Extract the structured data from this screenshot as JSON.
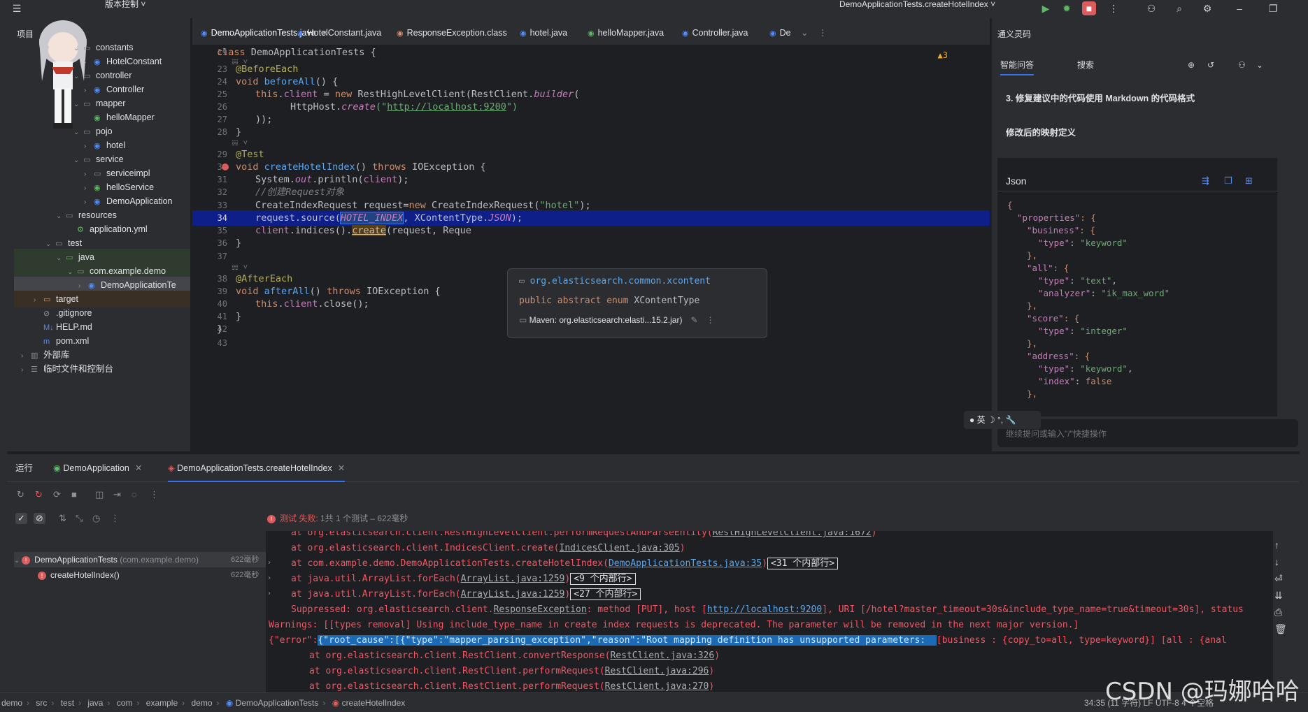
{
  "titlebar": {
    "vcs": "版本控制 ˅",
    "run_config": "DemoApplicationTests.createHotelIndex ˅"
  },
  "project": {
    "title": "项目",
    "items": [
      {
        "label": "constants",
        "type": "folder"
      },
      {
        "label": "HotelConstant",
        "type": "class"
      },
      {
        "label": "controller",
        "type": "folder"
      },
      {
        "label": "Controller",
        "type": "class"
      },
      {
        "label": "mapper",
        "type": "folder"
      },
      {
        "label": "helloMapper",
        "type": "interface"
      },
      {
        "label": "pojo",
        "type": "folder"
      },
      {
        "label": "hotel",
        "type": "class"
      },
      {
        "label": "service",
        "type": "folder"
      },
      {
        "label": "serviceimpl",
        "type": "folder"
      },
      {
        "label": "helloService",
        "type": "interface"
      },
      {
        "label": "DemoApplication",
        "type": "class"
      },
      {
        "label": "resources",
        "type": "folder"
      },
      {
        "label": "application.yml",
        "type": "file"
      },
      {
        "label": "test",
        "type": "folder"
      },
      {
        "label": "java",
        "type": "folder"
      },
      {
        "label": "com.example.demo",
        "type": "folder"
      },
      {
        "label": "DemoApplicationTe",
        "type": "class"
      },
      {
        "label": "target",
        "type": "folder"
      },
      {
        "label": ".gitignore",
        "type": "file"
      },
      {
        "label": "HELP.md",
        "type": "file"
      },
      {
        "label": "pom.xml",
        "type": "file"
      },
      {
        "label": "外部库",
        "type": "folder"
      },
      {
        "label": "临时文件和控制台",
        "type": "folder"
      }
    ]
  },
  "tabs": [
    {
      "label": "DemoApplicationTests.java",
      "active": true
    },
    {
      "label": "HotelConstant.java"
    },
    {
      "label": "ResponseException.class"
    },
    {
      "label": "hotel.java"
    },
    {
      "label": "helloMapper.java"
    },
    {
      "label": "Controller.java"
    },
    {
      "label": "De"
    }
  ],
  "editor": {
    "warnings": "▲3",
    "lines": {
      "l19": "19",
      "l23": "23",
      "l24": "24",
      "l25": "25",
      "l26": "26",
      "l27": "27",
      "l28": "28",
      "l29": "29",
      "l30": "30",
      "l31": "31",
      "l32": "32",
      "l33": "33",
      "l34": "34",
      "l35": "35",
      "l36": "36",
      "l37": "37",
      "l38": "38",
      "l39": "39",
      "l40": "40",
      "l41": "41",
      "l42": "42",
      "l43": "43"
    },
    "code": {
      "c19a": "class ",
      "c19b": "DemoApplicationTests {",
      "c23": "@BeforeEach",
      "c24a": "void ",
      "c24b": "beforeAll",
      "c24c": "() {",
      "c25a": "this",
      "c25b": ".",
      "c25c": "client",
      "c25d": " = ",
      "c25e": "new ",
      "c25f": "RestHighLevelClient(RestClient.",
      "c25g": "builder",
      "c25h": "(",
      "c26a": "HttpHost.",
      "c26b": "create",
      "c26c": "(\"",
      "c26d": "http://localhost:9200",
      "c26e": "\")",
      "c27": "));",
      "c28": "}",
      "c29": "@Test",
      "c30a": "void ",
      "c30b": "createHotelIndex",
      "c30c": "() ",
      "c30d": "throws ",
      "c30e": "IOException {",
      "c31a": "System.",
      "c31b": "out",
      "c31c": ".println(",
      "c31d": "client",
      "c31e": ");",
      "c32": "//创建Request对象",
      "c33a": "CreateIndexRequest request=",
      "c33b": "new ",
      "c33c": "CreateIndexRequest(",
      "c33d": "\"hotel\"",
      "c33e": ");",
      "c34a": "request.source(",
      "c34b": "HOTEL_INDEX",
      "c34c": ", XContentType.",
      "c34d": "JSON",
      "c34e": ");",
      "c35a": "client",
      "c35b": ".indices().",
      "c35c": "create",
      "c35d": "(request, Reque",
      "c36": "}",
      "c38": "@AfterEach",
      "c39a": "void ",
      "c39b": "afterAll",
      "c39c": "() ",
      "c39d": "throws ",
      "c39e": "IOException {",
      "c40a": "this",
      "c40b": ".",
      "c40c": "client",
      "c40d": ".close();",
      "c41": "}",
      "c42": "}"
    },
    "inlay": "𝍕 ˅",
    "popup": {
      "package": "org.elasticsearch.common.xcontent",
      "sig_a": "public abstract enum ",
      "sig_b": "XContentType",
      "maven": "Maven: org.elasticsearch:elasti...15.2.jar)"
    }
  },
  "ai": {
    "title": "通义灵码",
    "tab_chat": "智能问答",
    "tab_search": "搜索",
    "msg1": "3. 修复建议中的代码使用 Markdown 的代码格式",
    "msg2": "修改后的映射定义",
    "json_label": "Json",
    "json_lines": {
      "j1": "{",
      "j2k": "\"properties\"",
      "j2r": ": {",
      "j3k": "\"business\"",
      "j3r": ": {",
      "j4k": "\"type\"",
      "j4v": "\"keyword\"",
      "j5": "},",
      "j6k": "\"all\"",
      "j6r": ": {",
      "j7k": "\"type\"",
      "j7v": "\"text\"",
      "j8k": "\"analyzer\"",
      "j8v": "\"ik_max_word\"",
      "j9": "},",
      "j10k": "\"score\"",
      "j10r": ": {",
      "j11k": "\"type\"",
      "j11v": "\"integer\"",
      "j12": "},",
      "j13k": "\"address\"",
      "j13r": ": {",
      "j14k": "\"type\"",
      "j14v": "\"keyword\"",
      "j15k": "\"index\"",
      "j15v": "false",
      "j16": "},"
    },
    "input_placeholder": "继续提问或输入\"/\"快捷操作",
    "ime": "● 英 ☽ °, 🔧"
  },
  "run": {
    "label": "运行",
    "tab1": "DemoApplication",
    "tab2": "DemoApplicationTests.createHotelIndex",
    "status_a": "测试 失败:",
    "status_b": " 1共 1 个测试 – 622毫秒",
    "tree": {
      "root": "DemoApplicationTests",
      "root_pkg": " (com.example.demo)",
      "root_time": "622毫秒",
      "child": "createHotelIndex()",
      "child_time": "622毫秒"
    },
    "console": {
      "l1a": "at org.elasticsearch.client.RestHighLevelClient.performRequestAndParseEntity(",
      "l1b": "RestHighLevelClient.java:1672",
      "l1c": ")",
      "l2a": "at org.elasticsearch.client.IndicesClient.create(",
      "l2b": "IndicesClient.java:305",
      "l2c": ")",
      "l3a": "at com.example.demo.DemoApplicationTests.createHotelIndex(",
      "l3b": "DemoApplicationTests.java:35",
      "l3c": ")",
      "l3d": "<31 个内部行>",
      "l4a": "at java.util.ArrayList.forEach(",
      "l4b": "ArrayList.java:1259",
      "l4c": ")",
      "l4d": "<9 个内部行>",
      "l5a": "at java.util.ArrayList.forEach(",
      "l5b": "ArrayList.java:1259",
      "l5c": ")",
      "l5d": "<27 个内部行>",
      "l6a": "Suppressed: org.elasticsearch.client.",
      "l6b": "ResponseException",
      "l6c": ": method [PUT], host [",
      "l6d": "http://localhost:9200",
      "l6e": "], URI [/hotel?master_timeout=30s&include_type_name=true&timeout=30s], status",
      "l7": "Warnings: [[types removal] Using include_type_name in create index requests is deprecated. The parameter will be removed in the next major version.]",
      "l8a": "{\"error\":",
      "l8b": "{\"root_cause\":[{\"type\":\"mapper_parsing_exception\",\"reason\":\"Root mapping definition has unsupported parameters:  ",
      "l8c": "[business : {copy_to=all, type=keyword}] [all : {anal",
      "l9a": "at org.elasticsearch.client.RestClient.convertResponse(",
      "l9b": "RestClient.java:326",
      "l9c": ")",
      "l10a": "at org.elasticsearch.client.RestClient.performRequest(",
      "l10b": "RestClient.java:296",
      "l10c": ")",
      "l11a": "at org.elasticsearch.client.RestClient.performRequest(",
      "l11b": "RestClient.java:270",
      "l11c": ")"
    }
  },
  "statusbar": {
    "crumbs": [
      "demo",
      "src",
      "test",
      "java",
      "com",
      "example",
      "demo",
      "DemoApplicationTests",
      "createHotelIndex"
    ],
    "position": "34:35 (11 字符)   LF   UTF-8   4 个空格"
  },
  "watermark": "CSDN @玛娜哈哈"
}
